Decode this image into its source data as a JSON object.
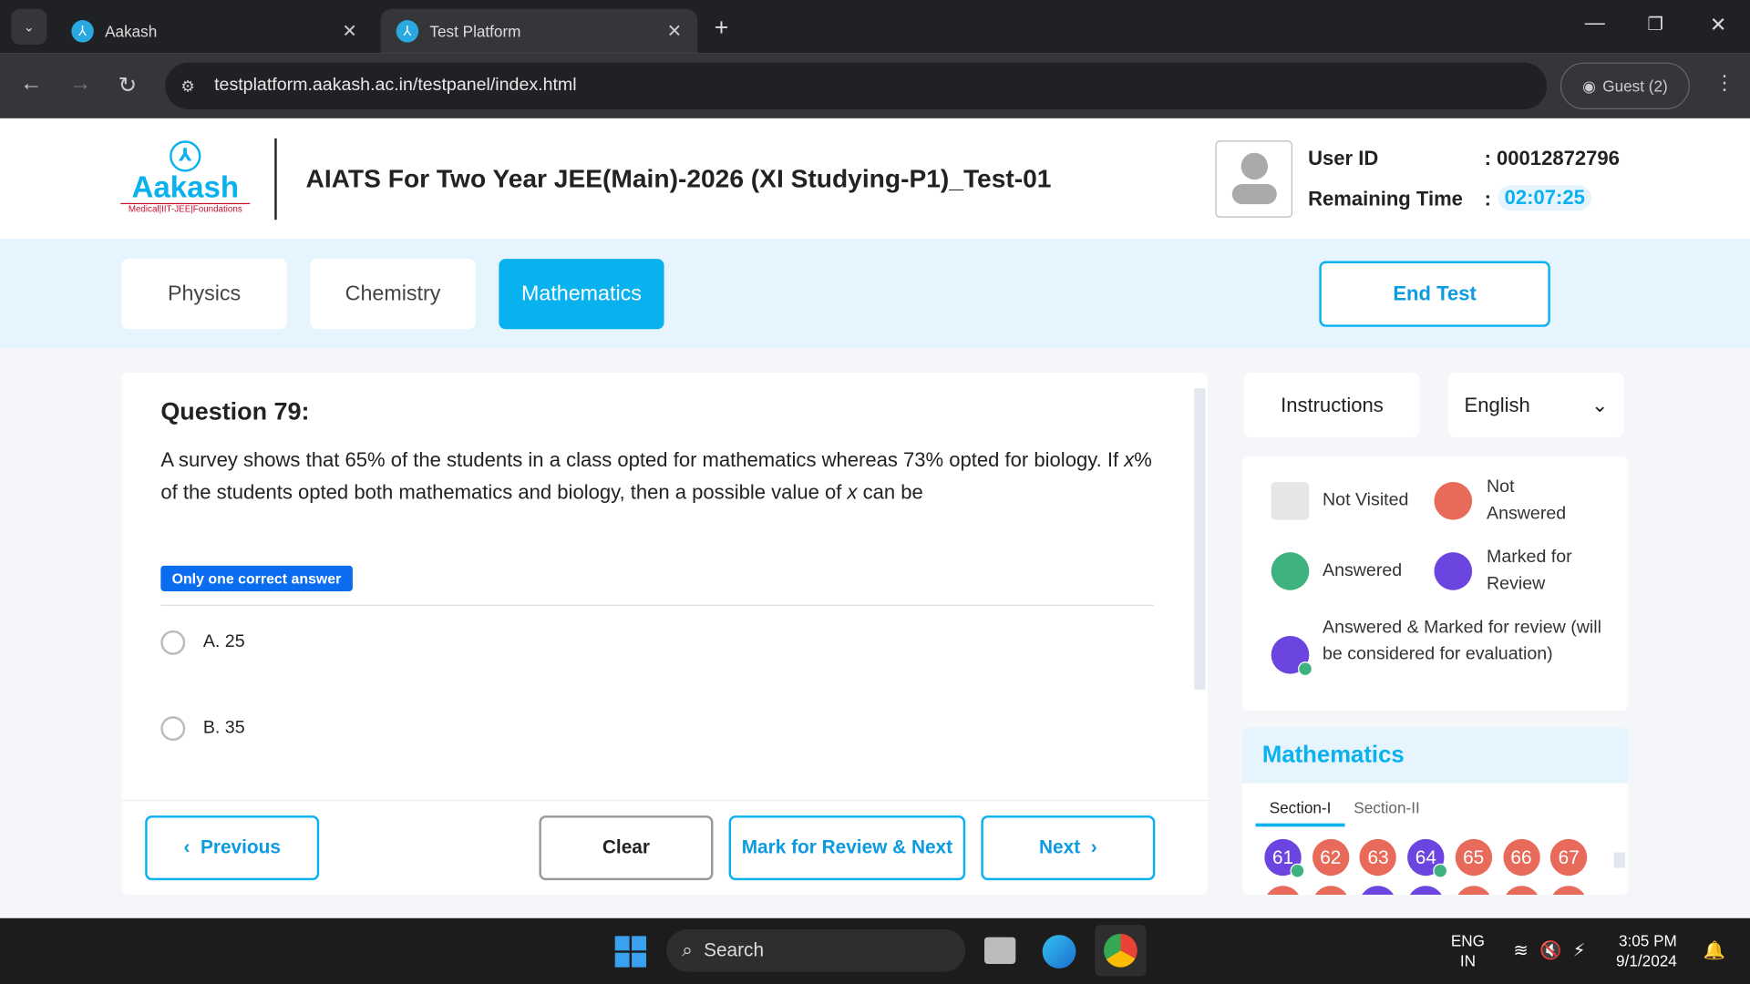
{
  "browser": {
    "tabs": [
      {
        "title": "Aakash"
      },
      {
        "title": "Test Platform"
      }
    ],
    "url": "testplatform.aakash.ac.in/testpanel/index.html",
    "profile": "Guest (2)"
  },
  "header": {
    "logo_text": "Aakash",
    "logo_tagline": "Medical|IIT-JEE|Foundations",
    "title": "AIATS For Two Year JEE(Main)-2026 (XI Studying-P1)_Test-01",
    "user_id_label": "User ID",
    "user_id": ": 00012872796",
    "time_label": "Remaining Time",
    "time_colon": ":",
    "time": "02:07:25"
  },
  "subjects": [
    {
      "label": "Physics"
    },
    {
      "label": "Chemistry"
    },
    {
      "label": "Mathematics",
      "active": true
    }
  ],
  "end_test": "End Test",
  "question": {
    "title": "Question 79:",
    "text_html": "A survey shows that 65% of the students in a class opted for mathematics whereas 73% opted for biology. If <i>x</i>% of the students opted both mathematics and biology, then a possible value of <i>x</i> can be",
    "type": "Only one correct answer",
    "options": [
      {
        "label": "A. 25"
      },
      {
        "label": "B. 35"
      }
    ]
  },
  "buttons": {
    "previous": "Previous",
    "clear": "Clear",
    "mark": "Mark for Review & Next",
    "next": "Next"
  },
  "side": {
    "instructions": "Instructions",
    "language": "English",
    "legend": {
      "not_visited": "Not Visited",
      "not_answered": "Not Answered",
      "answered": "Answered",
      "marked": "Marked for Review",
      "answered_marked": "Answered & Marked for review (will be considered for evaluation)"
    },
    "section_title": "Mathematics",
    "sections": [
      "Section-I",
      "Section-II"
    ],
    "palette": [
      {
        "n": "61",
        "status": "answered_marked"
      },
      {
        "n": "62",
        "status": "not_answered"
      },
      {
        "n": "63",
        "status": "not_answered"
      },
      {
        "n": "64",
        "status": "answered_marked"
      },
      {
        "n": "65",
        "status": "not_answered"
      },
      {
        "n": "66",
        "status": "not_answered"
      },
      {
        "n": "67",
        "status": "not_answered"
      }
    ],
    "palette_row2": [
      "not_answered",
      "not_answered",
      "marked",
      "marked",
      "not_answered",
      "not_answered",
      "not_answered"
    ]
  },
  "colors": {
    "accent": "#0ab1ef",
    "not_answered": "#e76a5a",
    "answered": "#3fb37f",
    "marked": "#6c44e0",
    "not_visited": "#e6e6e6"
  },
  "taskbar": {
    "search": "Search",
    "lang1": "ENG",
    "lang2": "IN",
    "time": "3:05 PM",
    "date": "9/1/2024"
  }
}
